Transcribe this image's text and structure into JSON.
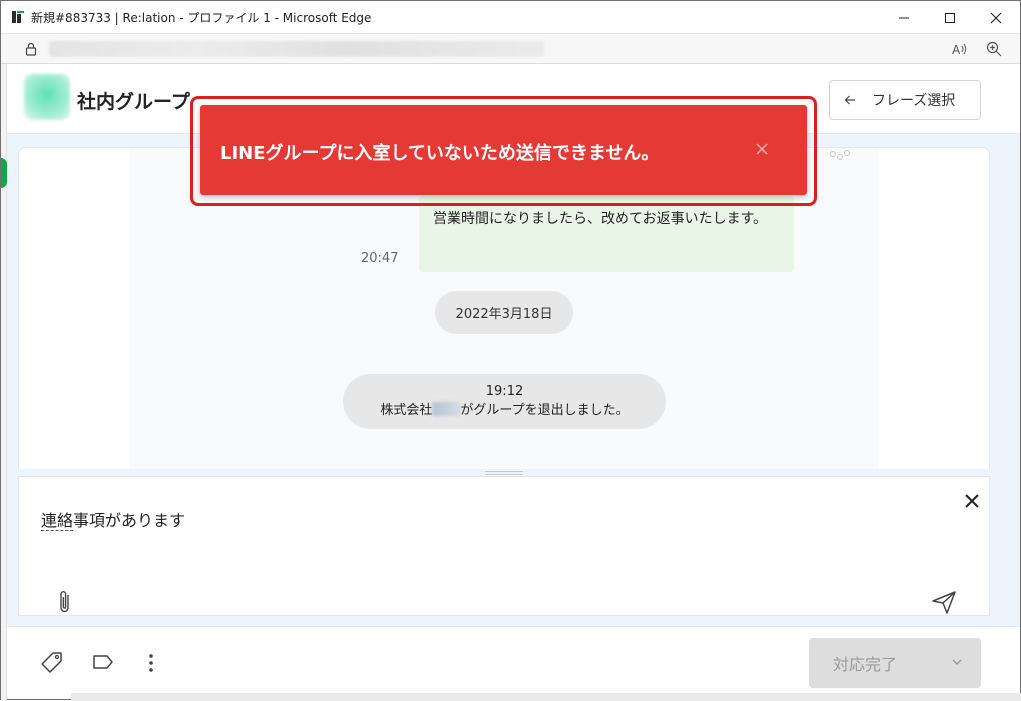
{
  "window": {
    "title": "新規#883733 | Re:lation - プロファイル 1 - Microsoft Edge"
  },
  "header": {
    "group_name": "社内グループ",
    "phrase_button_label": "フレーズ選択"
  },
  "chat": {
    "message_text": "営業時間になりましたら、改めてお返事いたします。",
    "message_time": "20:47",
    "date_separator": "2022年3月18日",
    "system_time": "19:12",
    "system_prefix": "株式会社",
    "system_suffix": "がグループを退出しました。"
  },
  "composer": {
    "draft_part1": "連絡",
    "draft_part2": "事項があります"
  },
  "footer": {
    "complete_button_label": "対応完了"
  },
  "toast": {
    "message": "LINEグループに入室していないため送信できません。"
  },
  "colors": {
    "toast_background": "#e53935",
    "highlight_border": "#e11d1d",
    "message_bubble": "#e9f6e7",
    "chat_background": "#eef4fb"
  },
  "icons": {
    "window_minimize": "minimize-icon",
    "window_maximize": "maximize-icon",
    "window_close": "close-icon",
    "address_lock": "lock-icon",
    "read_aloud": "read-aloud-icon",
    "zoom": "zoom-icon",
    "phrase_back": "arrow-left-icon",
    "composer_close": "close-icon",
    "attach": "paperclip-icon",
    "send": "send-icon",
    "tag": "tag-icon",
    "label": "label-icon",
    "more": "more-vertical-icon",
    "dropdown": "chevron-down-icon",
    "toast_close": "close-icon"
  }
}
